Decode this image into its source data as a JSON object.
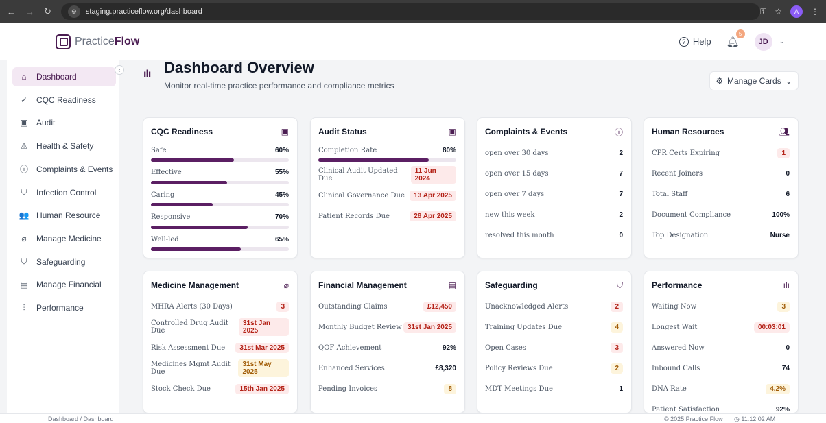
{
  "browser": {
    "url": "staging.practiceflow.org/dashboard",
    "profile": "A"
  },
  "header": {
    "logo_light": "Practice",
    "logo_bold": "Flow",
    "help": "Help",
    "notifications": "5",
    "user": "JD"
  },
  "sidebar": {
    "items": [
      {
        "label": "Dashboard",
        "icon": "home-icon",
        "glyph": "⌂",
        "active": true
      },
      {
        "label": "CQC Readiness",
        "icon": "check-circle-icon",
        "glyph": "✓"
      },
      {
        "label": "Audit",
        "icon": "clipboard-icon",
        "glyph": "▣"
      },
      {
        "label": "Health & Safety",
        "icon": "warning-icon",
        "glyph": "⚠"
      },
      {
        "label": "Complaints & Events",
        "icon": "alert-circle-icon",
        "glyph": "ⓘ"
      },
      {
        "label": "Infection Control",
        "icon": "shield-icon",
        "glyph": "⛉"
      },
      {
        "label": "Human Resource",
        "icon": "users-icon",
        "glyph": "👥"
      },
      {
        "label": "Manage Medicine",
        "icon": "pill-icon",
        "glyph": "⌀"
      },
      {
        "label": "Safeguarding",
        "icon": "shield-check-icon",
        "glyph": "⛉"
      },
      {
        "label": "Manage Financial",
        "icon": "wallet-icon",
        "glyph": "▤"
      },
      {
        "label": "Performance",
        "icon": "bar-chart-icon",
        "glyph": "⫶"
      }
    ]
  },
  "main": {
    "title": "Dashboard Overview",
    "subtitle": "Monitor real-time practice performance and compliance metrics",
    "manage_cards": "Manage Cards"
  },
  "cards": {
    "cqc": {
      "title": "CQC Readiness",
      "items": [
        {
          "label": "Safe",
          "value": "60%",
          "level": 0.6
        },
        {
          "label": "Effective",
          "value": "55%",
          "level": 0.55
        },
        {
          "label": "Caring",
          "value": "45%",
          "level": 0.45
        },
        {
          "label": "Responsive",
          "value": "70%",
          "level": 0.7
        },
        {
          "label": "Well-led",
          "value": "65%",
          "level": 0.65
        }
      ]
    },
    "audit": {
      "title": "Audit Status",
      "completion_label": "Completion Rate",
      "completion_value": "80%",
      "completion_level": 0.8,
      "items": [
        {
          "label": "Clinical Audit Updated Due",
          "value": "11 Jun 2024"
        },
        {
          "label": "Clinical Governance Due",
          "value": "13 Apr 2025"
        },
        {
          "label": "Patient Records Due",
          "value": "28 Apr 2025"
        }
      ]
    },
    "complaints": {
      "title": "Complaints & Events",
      "items": [
        {
          "label": "open over 30 days",
          "value": "2"
        },
        {
          "label": "open over 15 days",
          "value": "7"
        },
        {
          "label": "open over 7 days",
          "value": "7"
        },
        {
          "label": "new this week",
          "value": "2"
        },
        {
          "label": "resolved this month",
          "value": "0"
        }
      ]
    },
    "hr": {
      "title": "Human Resources",
      "items": [
        {
          "label": "CPR Certs Expiring",
          "value": "1"
        },
        {
          "label": "Recent Joiners",
          "value": "0"
        },
        {
          "label": "Total Staff",
          "value": "6"
        },
        {
          "label": "Document Compliance",
          "value": "100%"
        },
        {
          "label": "Top Designation",
          "value": "Nurse"
        }
      ]
    },
    "medicine": {
      "title": "Medicine Management",
      "items": [
        {
          "label": "MHRA Alerts (30 Days)",
          "value": "3"
        },
        {
          "label": "Controlled Drug Audit Due",
          "value": "31st Jan 2025"
        },
        {
          "label": "Risk Assessment Due",
          "value": "31st Mar 2025"
        },
        {
          "label": "Medicines Mgmt Audit Due",
          "value": "31st May 2025"
        },
        {
          "label": "Stock Check Due",
          "value": "15th Jan 2025"
        }
      ]
    },
    "financial": {
      "title": "Financial Management",
      "items": [
        {
          "label": "Outstanding Claims",
          "value": "£12,450"
        },
        {
          "label": "Monthly Budget Review",
          "value": "31st Jan 2025"
        },
        {
          "label": "QOF Achievement",
          "value": "92%"
        },
        {
          "label": "Enhanced Services",
          "value": "£8,320"
        },
        {
          "label": "Pending Invoices",
          "value": "8"
        }
      ]
    },
    "safeguarding": {
      "title": "Safeguarding",
      "items": [
        {
          "label": "Unacknowledged Alerts",
          "value": "2"
        },
        {
          "label": "Training Updates Due",
          "value": "4"
        },
        {
          "label": "Open Cases",
          "value": "3"
        },
        {
          "label": "Policy Reviews Due",
          "value": "2"
        },
        {
          "label": "MDT Meetings Due",
          "value": "1"
        }
      ]
    },
    "performance": {
      "title": "Performance",
      "items": [
        {
          "label": "Waiting Now",
          "value": "3"
        },
        {
          "label": "Longest Wait",
          "value": "00:03:01"
        },
        {
          "label": "Answered Now",
          "value": "0"
        },
        {
          "label": "Inbound Calls",
          "value": "74"
        },
        {
          "label": "DNA Rate",
          "value": "4.2%"
        },
        {
          "label": "Patient Satisfaction",
          "value": "92%"
        }
      ]
    }
  },
  "footer": {
    "breadcrumb": "Dashboard  /  Dashboard",
    "copyright": "© 2025 Practice Flow",
    "time": "11:12:02 AM"
  }
}
